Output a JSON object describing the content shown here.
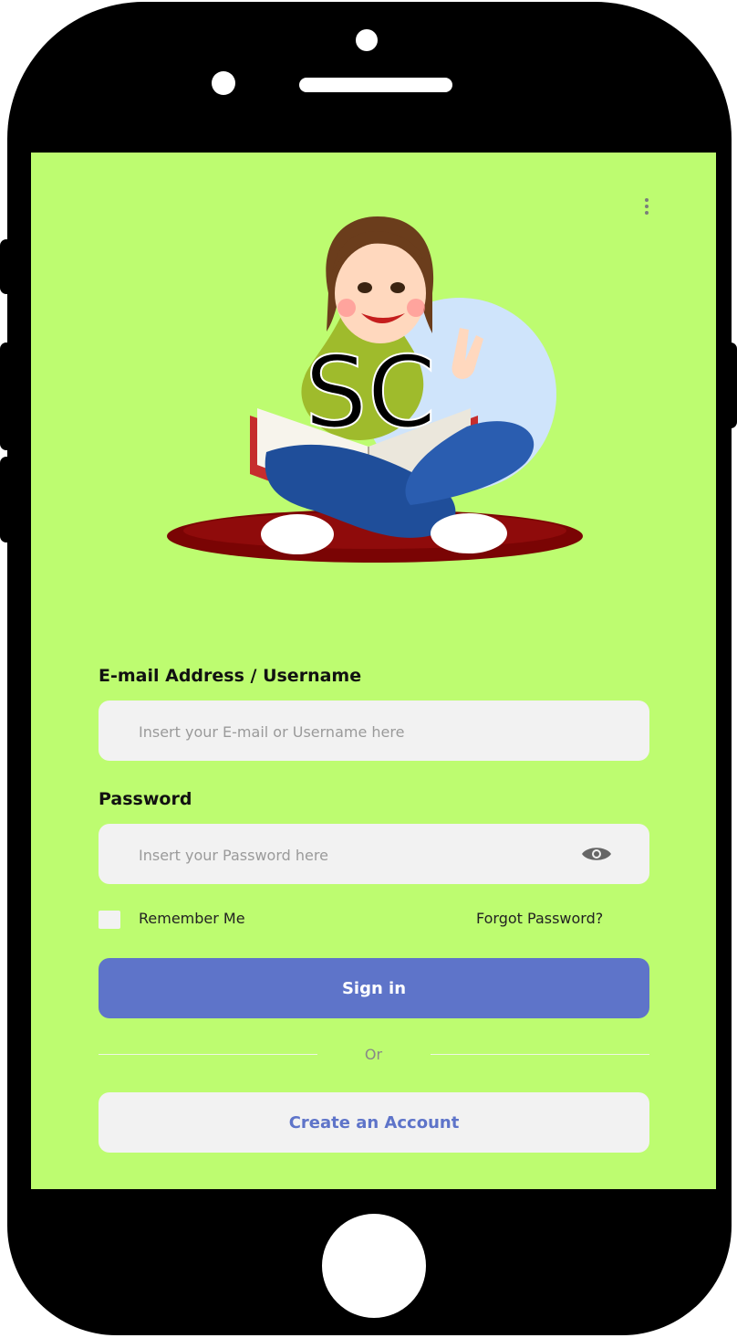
{
  "app": {
    "logo_text": "SC"
  },
  "form": {
    "email_label": "E-mail Address / Username",
    "email_placeholder": "Insert your E-mail or Username here",
    "password_label": "Password",
    "password_placeholder": "Insert your Password here",
    "remember_label": "Remember Me",
    "forgot_label": "Forgot Password?",
    "signin_label": "Sign in",
    "or_label": "Or",
    "create_label": "Create an Account"
  },
  "icons": {
    "menu": "more-vertical-icon",
    "password_toggle": "eye-icon"
  },
  "colors": {
    "screen_background": "#bdfc70",
    "primary_button": "#5e74c9",
    "field_background": "#f2f2f2",
    "device_frame": "#000000"
  }
}
